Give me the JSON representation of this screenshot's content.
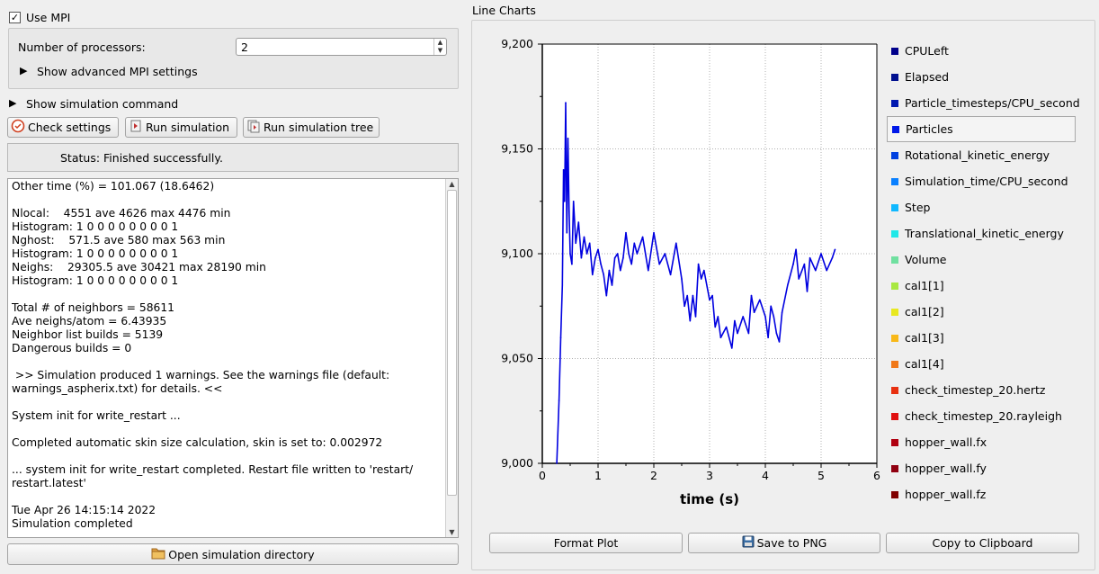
{
  "mpi": {
    "use_mpi_label": "Use MPI",
    "use_mpi_checked": "✓",
    "processors_label": "Number of processors:",
    "processors_value": "2",
    "advanced_label": "Show advanced MPI settings"
  },
  "simulation": {
    "show_command_label": "Show simulation command",
    "check_settings": "Check settings",
    "run_simulation": "Run simulation",
    "run_tree": "Run simulation tree",
    "status": "Status: Finished successfully.",
    "open_dir": "Open simulation directory"
  },
  "log_lines": [
    "Other time (%) = 101.067 (18.6462)",
    "",
    "Nlocal:    4551 ave 4626 max 4476 min",
    "Histogram: 1 0 0 0 0 0 0 0 0 1",
    "Nghost:    571.5 ave 580 max 563 min",
    "Histogram: 1 0 0 0 0 0 0 0 0 1",
    "Neighs:    29305.5 ave 30421 max 28190 min",
    "Histogram: 1 0 0 0 0 0 0 0 0 1",
    "",
    "Total # of neighbors = 58611",
    "Ave neighs/atom = 6.43935",
    "Neighbor list builds = 5139",
    "Dangerous builds = 0",
    "",
    " >> Simulation produced 1 warnings. See the warnings file (default:",
    "warnings_aspherix.txt) for details. <<",
    "",
    "System init for write_restart ...",
    "",
    "Completed automatic skin size calculation, skin is set to: 0.002972",
    "",
    "... system init for write_restart completed. Restart file written to 'restart/",
    "restart.latest'",
    "",
    "Tue Apr 26 14:15:14 2022",
    "Simulation completed"
  ],
  "chart_panel": {
    "title": "Line Charts",
    "format_plot": "Format Plot",
    "save_png": "Save to PNG",
    "copy_clipboard": "Copy to Clipboard"
  },
  "legend": [
    {
      "name": "CPULeft",
      "color": "#00008b"
    },
    {
      "name": "Elapsed",
      "color": "#00108f"
    },
    {
      "name": "Particle_timesteps/CPU_second",
      "color": "#0018b0"
    },
    {
      "name": "Particles",
      "color": "#0018e8",
      "selected": true
    },
    {
      "name": "Rotational_kinetic_energy",
      "color": "#0040e0"
    },
    {
      "name": "Simulation_time/CPU_second",
      "color": "#0a80ff"
    },
    {
      "name": "Step",
      "color": "#10b8ff"
    },
    {
      "name": "Translational_kinetic_energy",
      "color": "#20e8e8"
    },
    {
      "name": "Volume",
      "color": "#70e0a0"
    },
    {
      "name": "cal1[1]",
      "color": "#a8e840"
    },
    {
      "name": "cal1[2]",
      "color": "#e8e820"
    },
    {
      "name": "cal1[3]",
      "color": "#f8b818"
    },
    {
      "name": "cal1[4]",
      "color": "#f07818"
    },
    {
      "name": "check_timestep_20.hertz",
      "color": "#e83010"
    },
    {
      "name": "check_timestep_20.rayleigh",
      "color": "#e01010"
    },
    {
      "name": "hopper_wall.fx",
      "color": "#b00010"
    },
    {
      "name": "hopper_wall.fy",
      "color": "#900010"
    },
    {
      "name": "hopper_wall.fz",
      "color": "#800000"
    }
  ],
  "chart_data": {
    "type": "line",
    "xlabel": "time (s)",
    "ylabel": "",
    "xlim": [
      0,
      6
    ],
    "ylim": [
      9000,
      9200
    ],
    "x_ticks": [
      "0",
      "1",
      "2",
      "3",
      "4",
      "5",
      "6"
    ],
    "y_ticks": [
      "9,000",
      "9,050",
      "9,100",
      "9,150",
      "9,200"
    ],
    "grid": true,
    "series": [
      {
        "name": "Particles",
        "color": "#0000e0",
        "x": [
          0.26,
          0.3,
          0.33,
          0.36,
          0.38,
          0.4,
          0.42,
          0.44,
          0.46,
          0.48,
          0.5,
          0.53,
          0.56,
          0.6,
          0.65,
          0.7,
          0.75,
          0.8,
          0.85,
          0.9,
          0.95,
          1.0,
          1.05,
          1.1,
          1.15,
          1.2,
          1.25,
          1.3,
          1.35,
          1.4,
          1.45,
          1.5,
          1.55,
          1.6,
          1.65,
          1.7,
          1.8,
          1.9,
          2.0,
          2.1,
          2.2,
          2.3,
          2.4,
          2.5,
          2.55,
          2.6,
          2.65,
          2.7,
          2.75,
          2.8,
          2.85,
          2.9,
          3.0,
          3.05,
          3.1,
          3.15,
          3.2,
          3.3,
          3.4,
          3.45,
          3.5,
          3.6,
          3.7,
          3.75,
          3.8,
          3.9,
          4.0,
          4.05,
          4.1,
          4.15,
          4.2,
          4.25,
          4.3,
          4.4,
          4.5,
          4.55,
          4.6,
          4.7,
          4.75,
          4.8,
          4.9,
          5.0,
          5.1,
          5.2,
          5.25
        ],
        "y": [
          9000,
          9030,
          9060,
          9085,
          9140,
          9125,
          9172,
          9110,
          9155,
          9120,
          9100,
          9095,
          9125,
          9105,
          9115,
          9098,
          9108,
          9100,
          9105,
          9090,
          9098,
          9102,
          9095,
          9090,
          9080,
          9092,
          9085,
          9098,
          9100,
          9092,
          9098,
          9110,
          9100,
          9095,
          9105,
          9100,
          9108,
          9092,
          9110,
          9095,
          9100,
          9090,
          9105,
          9088,
          9075,
          9080,
          9068,
          9080,
          9070,
          9095,
          9088,
          9092,
          9078,
          9080,
          9065,
          9070,
          9060,
          9065,
          9055,
          9068,
          9062,
          9070,
          9062,
          9080,
          9072,
          9078,
          9070,
          9060,
          9075,
          9070,
          9062,
          9058,
          9072,
          9085,
          9095,
          9102,
          9088,
          9095,
          9082,
          9098,
          9092,
          9100,
          9092,
          9098,
          9102
        ]
      }
    ]
  }
}
